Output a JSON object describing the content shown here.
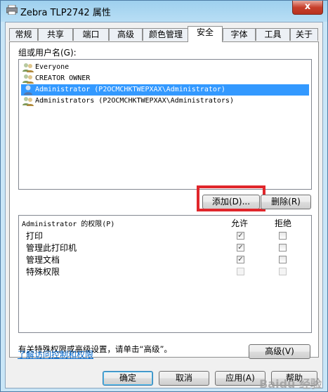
{
  "window": {
    "title": "Zebra TLP2742 属性",
    "close_label": "x"
  },
  "tabs": [
    {
      "label": "常规"
    },
    {
      "label": "共享"
    },
    {
      "label": "端口"
    },
    {
      "label": "高级"
    },
    {
      "label": "颜色管理"
    },
    {
      "label": "安全"
    },
    {
      "label": "字体"
    },
    {
      "label": "工具"
    },
    {
      "label": "关于"
    }
  ],
  "active_tab": "安全",
  "security": {
    "groups_label": "组或用户名(G):",
    "users": [
      {
        "name": "Everyone",
        "selected": false
      },
      {
        "name": "CREATOR OWNER",
        "selected": false
      },
      {
        "name": "Administrator (P2OCMCHKTWEPXAX\\Administrator)",
        "selected": true
      },
      {
        "name": "Administrators (P2OCMCHKTWEPXAX\\Administrators)",
        "selected": false
      }
    ],
    "add_button": "添加(D)...",
    "remove_button": "删除(R)",
    "permissions_header": "Administrator 的权限(P)",
    "allow_header": "允许",
    "deny_header": "拒绝",
    "permissions": [
      {
        "name": "打印",
        "allow": true,
        "deny": false,
        "enabled": true
      },
      {
        "name": "管理此打印机",
        "allow": true,
        "deny": false,
        "enabled": true
      },
      {
        "name": "管理文档",
        "allow": true,
        "deny": false,
        "enabled": true
      },
      {
        "name": "特殊权限",
        "allow": false,
        "deny": false,
        "enabled": false
      }
    ],
    "advanced_hint": "有关特殊权限或高级设置，请单击“高级”。",
    "advanced_button": "高级(V)",
    "learn_link": "了解访问控制和权限"
  },
  "footer": {
    "ok": "确定",
    "cancel": "取消",
    "apply": "应用(A)",
    "help": "帮助"
  },
  "watermark": "Baidu 经验",
  "colors": {
    "selection": "#3399ff",
    "highlight_box": "#e0262b",
    "link": "#0066cc"
  }
}
